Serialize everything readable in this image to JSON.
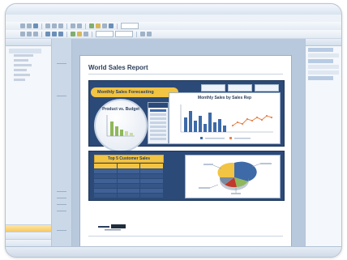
{
  "window": {
    "title": ""
  },
  "menu": [
    "",
    "",
    "",
    "",
    "",
    "",
    "",
    "",
    ""
  ],
  "report": {
    "title": "World Sales Report",
    "banner": "Monthly Sales Forecasting",
    "circle_title": "Product vs. Budget",
    "card_title": "Monthly Sales by Sales Rep",
    "table_title": "Top 5 Customer Sales"
  },
  "colors": {
    "panel_blue": "#2c4a78",
    "accent_yellow": "#f2c444",
    "bar_blue": "#3e6aa8",
    "line_orange": "#e8834a"
  },
  "left_panel": {
    "nav_items": [
      "",
      "",
      ""
    ]
  },
  "statusbar": [
    "",
    "",
    ""
  ]
}
